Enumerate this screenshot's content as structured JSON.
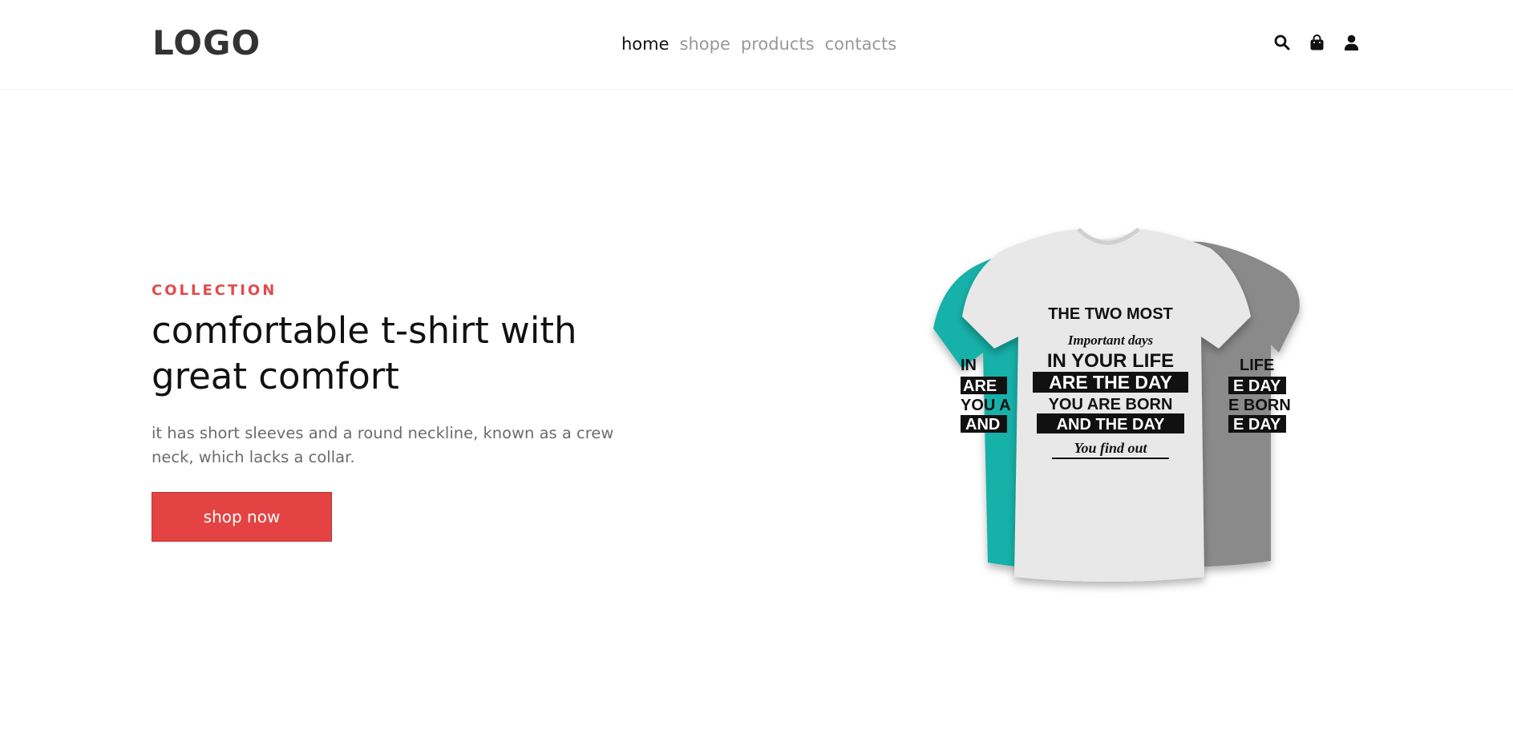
{
  "header": {
    "logo": "LOGO",
    "nav": [
      "home",
      "shope",
      "products",
      "contacts"
    ],
    "icons": [
      "search-icon",
      "shopping-bag-icon",
      "user-icon"
    ]
  },
  "hero": {
    "eyebrow": "COLLECTION",
    "title": "comfortable t-shirt with great comfort",
    "description": "it has short sleeves and a round neckline, known as a crew neck, which lacks a collar.",
    "cta_label": "shop now",
    "accent_color": "#e44343",
    "tshirt_colors": [
      "#13b1a9",
      "#e6e6e6",
      "#8a8a8a"
    ],
    "print_text": [
      "THE TWO MOST",
      "Important days",
      "IN YOUR LIFE",
      "ARE THE DAY",
      "YOU ARE BORN",
      "AND THE DAY",
      "You find out"
    ]
  }
}
